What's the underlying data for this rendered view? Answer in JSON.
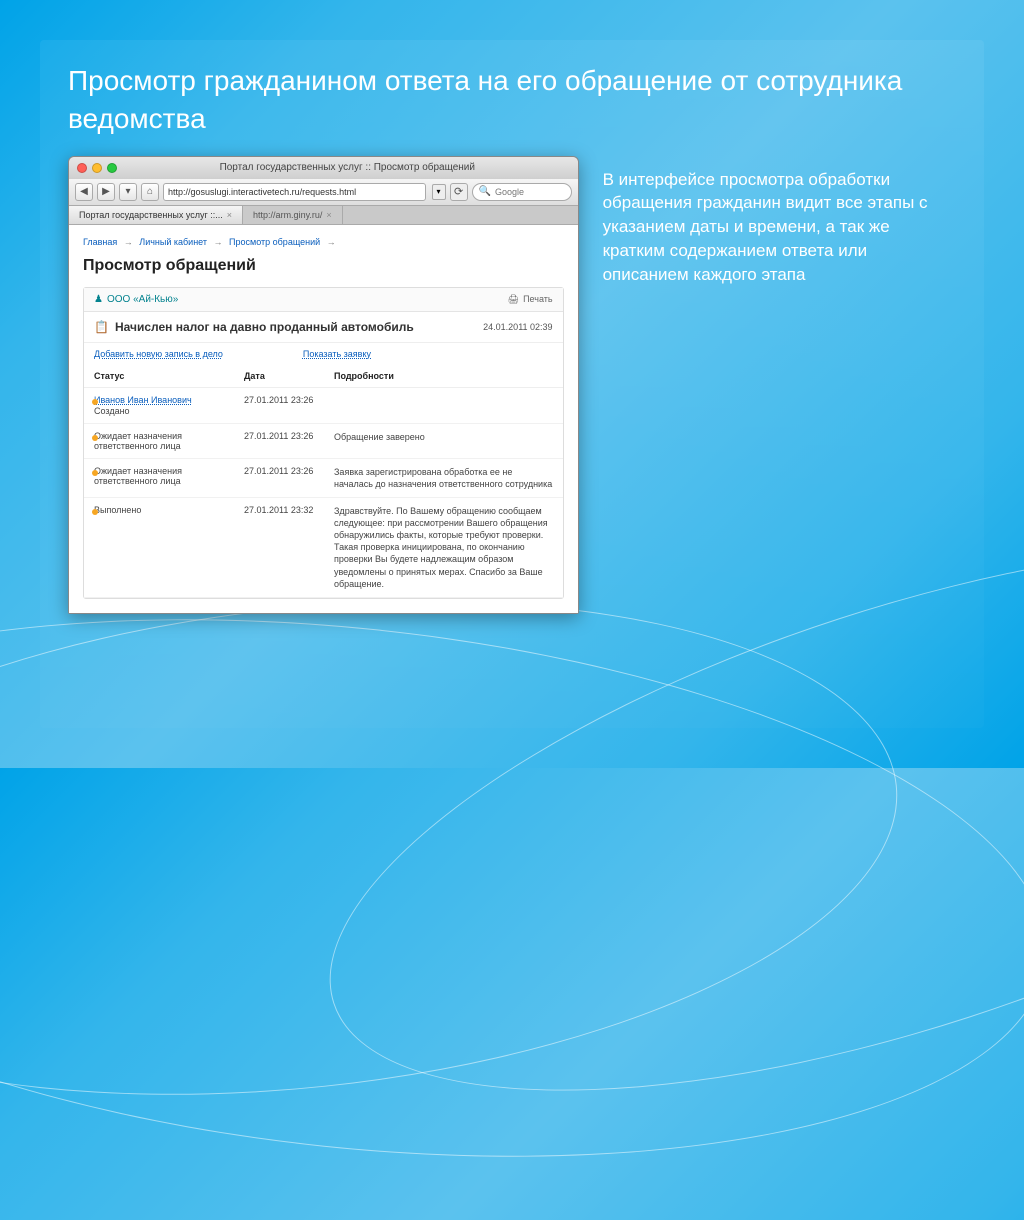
{
  "slide": {
    "title": "Просмотр гражданином ответа на его обращение от сотрудника ведомства",
    "side_text": "В интерфейсе просмотра обработки обращения гражданин видит все этапы с указанием даты и времени, а так же кратким содержанием ответа или описанием каждого этапа"
  },
  "browser": {
    "window_title": "Портал государственных услуг :: Просмотр обращений",
    "url": "http://gosuslugi.interactivetech.ru/requests.html",
    "search_placeholder": "Google",
    "tabs": [
      {
        "label": "Портал государственных услуг ::..."
      },
      {
        "label": "http://arm.giny.ru/"
      }
    ]
  },
  "page": {
    "breadcrumb": {
      "a": "Главная",
      "b": "Личный кабинет",
      "c": "Просмотр обращений"
    },
    "heading": "Просмотр обращений",
    "org_name": "ООО «Ай-Кью»",
    "print_label": "Печать",
    "request_title": "Начислен налог на давно проданный автомобиль",
    "request_datetime": "24.01.2011 02:39",
    "link_add": "Добавить новую запись в дело",
    "link_show": "Показать заявку",
    "columns": {
      "status": "Статус",
      "date": "Дата",
      "details": "Подробности"
    },
    "rows": [
      {
        "author": "Иванов Иван Иванович",
        "status": "Создано",
        "date": "27.01.2011 23:26",
        "details": ""
      },
      {
        "status": "Ожидает назначения ответственного лица",
        "date": "27.01.2011 23:26",
        "details": "Обращение заверено"
      },
      {
        "status": "Ожидает назначения ответственного лица",
        "date": "27.01.2011 23:26",
        "details": "Заявка зарегистрирована обработка ее не началась до назначения ответственного сотрудника"
      },
      {
        "status": "Выполнено",
        "date": "27.01.2011 23:32",
        "details": "Здравствуйте. По Вашему обращению сообщаем следующее: при рассмотрении Вашего обращения обнаружились факты, которые требуют проверки. Такая проверка инициирована, по окончанию проверки Вы будете надлежащим образом уведомлены о принятых мерах. Спасибо за Ваше обращение."
      }
    ]
  }
}
